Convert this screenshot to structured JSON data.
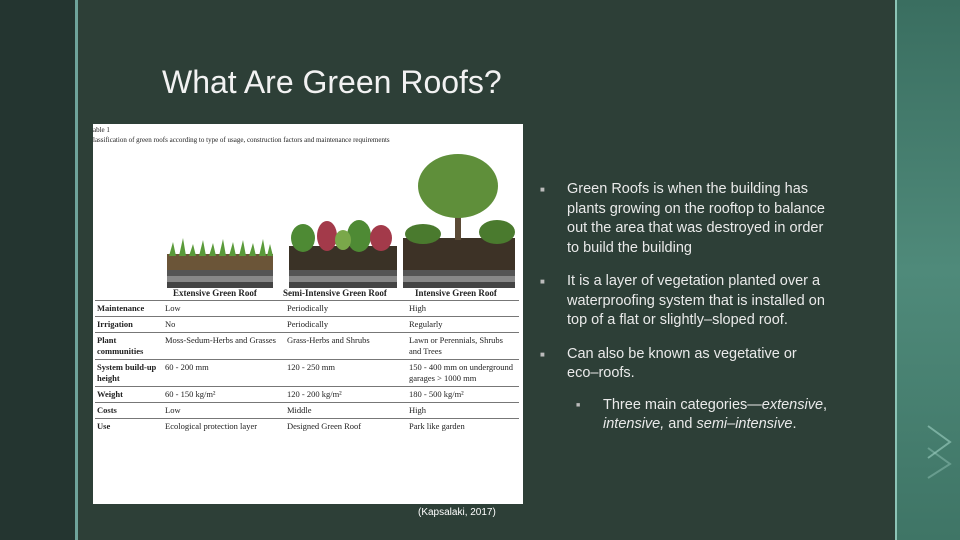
{
  "slide": {
    "title": "What Are Green Roofs?",
    "credit": "(Kapsalaki, 2017)"
  },
  "figure": {
    "label": "able 1",
    "caption": "lassification of green roofs according to type of usage, construction factors and maintenance requirements",
    "roof_types": [
      "Extensive Green Roof",
      "Semi-Intensive Green Roof",
      "Intensive Green Roof"
    ],
    "rows": [
      {
        "label": "Maintenance",
        "extensive": "Low",
        "semi": "Periodically",
        "intensive": "High"
      },
      {
        "label": "Irrigation",
        "extensive": "No",
        "semi": "Periodically",
        "intensive": "Regularly"
      },
      {
        "label": "Plant communities",
        "extensive": "Moss-Sedum-Herbs and Grasses",
        "semi": "Grass-Herbs and Shrubs",
        "intensive": "Lawn or Perennials, Shrubs and Trees"
      },
      {
        "label": "System build-up height",
        "extensive": "60 - 200 mm",
        "semi": "120 - 250 mm",
        "intensive": "150 - 400 mm on underground garages > 1000 mm"
      },
      {
        "label": "Weight",
        "extensive": "60 - 150 kg/m²",
        "semi": "120 - 200 kg/m²",
        "intensive": "180 - 500 kg/m²"
      },
      {
        "label": "Costs",
        "extensive": "Low",
        "semi": "Middle",
        "intensive": "High"
      },
      {
        "label": "Use",
        "extensive": "Ecological protection layer",
        "semi": "Designed Green Roof",
        "intensive": "Park like garden"
      }
    ]
  },
  "bullets": [
    "Green Roofs is when the building has plants growing on the rooftop to balance out the area that was destroyed in order to build the building",
    "It is a layer of vegetation planted over a waterproofing system that is installed on top of a flat or slightly–sloped roof.",
    "Can also be known as vegetative or eco–roofs."
  ],
  "sub_bullet": {
    "prefix": "Three main categories—",
    "cat1": "extensive",
    "sep1": ", ",
    "cat2": "intensive,",
    "sep2": " and ",
    "cat3": "semi–intensive",
    "suffix": "."
  },
  "colors": {
    "background": "#22302b",
    "panel": "#2d3f37",
    "accent_line": "#6fa39a",
    "right_band": "#4f8a7a"
  }
}
